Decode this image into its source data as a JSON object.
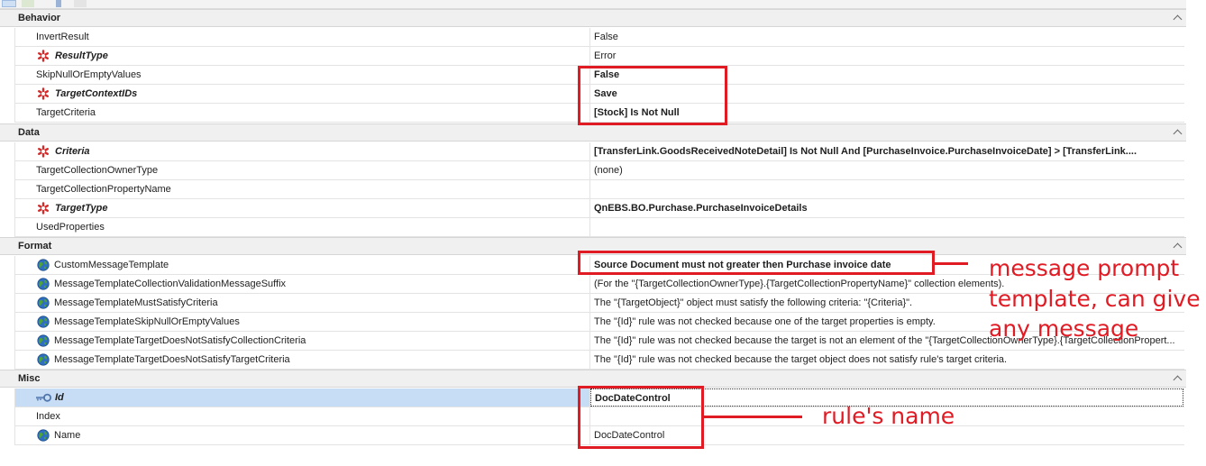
{
  "categories": [
    {
      "name": "Behavior",
      "rows": [
        {
          "name": "InvertResult",
          "value": "False",
          "marker": "none",
          "bold": false
        },
        {
          "name": "ResultType",
          "value": "Error",
          "marker": "required",
          "bold": false
        },
        {
          "name": "SkipNullOrEmptyValues",
          "value": "False",
          "marker": "none",
          "bold": true
        },
        {
          "name": "TargetContextIDs",
          "value": "Save",
          "marker": "required",
          "bold": true
        },
        {
          "name": "TargetCriteria",
          "value": "[Stock] Is Not Null",
          "marker": "none",
          "bold": true
        }
      ]
    },
    {
      "name": "Data",
      "rows": [
        {
          "name": "Criteria",
          "value": "[TransferLink.GoodsReceivedNoteDetail] Is Not Null And [PurchaseInvoice.PurchaseInvoiceDate] > [TransferLink....",
          "marker": "required",
          "bold": true
        },
        {
          "name": "TargetCollectionOwnerType",
          "value": "(none)",
          "marker": "none",
          "bold": false
        },
        {
          "name": "TargetCollectionPropertyName",
          "value": "",
          "marker": "none",
          "bold": false
        },
        {
          "name": "TargetType",
          "value": "QnEBS.BO.Purchase.PurchaseInvoiceDetails",
          "marker": "required",
          "bold": true
        },
        {
          "name": "UsedProperties",
          "value": "",
          "marker": "none",
          "bold": false
        }
      ]
    },
    {
      "name": "Format",
      "rows": [
        {
          "name": "CustomMessageTemplate",
          "value": "Source Document must not greater then Purchase invoice date",
          "marker": "globe",
          "bold": true
        },
        {
          "name": "MessageTemplateCollectionValidationMessageSuffix",
          "value": "(For the \"{TargetCollectionOwnerType}.{TargetCollectionPropertyName}\" collection elements).",
          "marker": "globe",
          "bold": false
        },
        {
          "name": "MessageTemplateMustSatisfyCriteria",
          "value": "The \"{TargetObject}\" object must satisfy the following criteria: \"{Criteria}\".",
          "marker": "globe",
          "bold": false
        },
        {
          "name": "MessageTemplateSkipNullOrEmptyValues",
          "value": "The \"{Id}\" rule was not checked because one of the target properties is empty.",
          "marker": "globe",
          "bold": false
        },
        {
          "name": "MessageTemplateTargetDoesNotSatisfyCollectionCriteria",
          "value": "The \"{Id}\" rule was not checked because the target is not an element of the \"{TargetCollectionOwnerType}.{TargetCollectionPropert...",
          "marker": "globe",
          "bold": false
        },
        {
          "name": "MessageTemplateTargetDoesNotSatisfyTargetCriteria",
          "value": "The \"{Id}\" rule was not checked because the target object does not satisfy rule's target criteria.",
          "marker": "globe",
          "bold": false
        }
      ]
    },
    {
      "name": "Misc",
      "rows": [
        {
          "name": "Id",
          "value": "DocDateControl",
          "marker": "key",
          "bold": true,
          "selected": true
        },
        {
          "name": "Index",
          "value": "",
          "marker": "none",
          "bold": false
        },
        {
          "name": "Name",
          "value": "DocDateControl",
          "marker": "globe",
          "bold": false
        }
      ]
    }
  ],
  "annotations": {
    "message_note_line1": "message prompt",
    "message_note_line2": "template, can give",
    "message_note_line3": "any message",
    "name_note": "rule's name"
  },
  "colors": {
    "annotation": "#e01b24",
    "required_marker": "#d42a2a",
    "selected_row": "#c7dcf5",
    "category_bg": "#f0f0f0"
  },
  "icons": {
    "required": "required-asterisk-icon",
    "globe": "globe-icon",
    "key": "key-icon",
    "collapse": "chevron-up-icon"
  }
}
